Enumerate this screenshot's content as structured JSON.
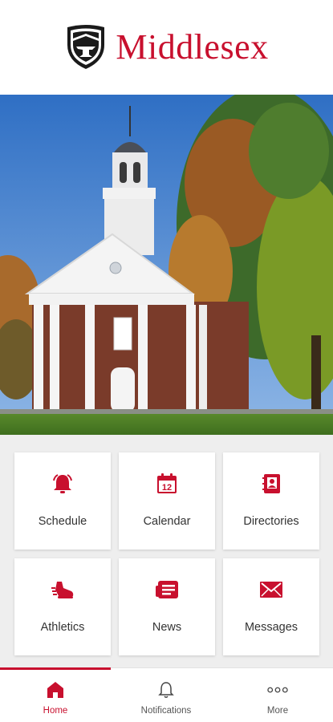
{
  "header": {
    "brand_name": "Middlesex",
    "logo_icon": "crest-shield-icon"
  },
  "hero": {
    "image": "chapel-photo"
  },
  "tiles": [
    {
      "label": "Schedule",
      "icon": "bell-icon"
    },
    {
      "label": "Calendar",
      "icon": "calendar-icon",
      "icon_text": "12"
    },
    {
      "label": "Directories",
      "icon": "contact-book-icon"
    },
    {
      "label": "Athletics",
      "icon": "running-shoe-icon"
    },
    {
      "label": "News",
      "icon": "newspaper-icon"
    },
    {
      "label": "Messages",
      "icon": "envelope-icon"
    }
  ],
  "tabbar": {
    "items": [
      {
        "label": "Home",
        "icon": "home-icon",
        "active": true
      },
      {
        "label": "Notifications",
        "icon": "bell-outline-icon",
        "active": false
      },
      {
        "label": "More",
        "icon": "more-dots-icon",
        "active": false
      }
    ]
  },
  "colors": {
    "accent": "#c8102e",
    "grid_background": "#eeeeee",
    "tile_background": "#ffffff"
  }
}
